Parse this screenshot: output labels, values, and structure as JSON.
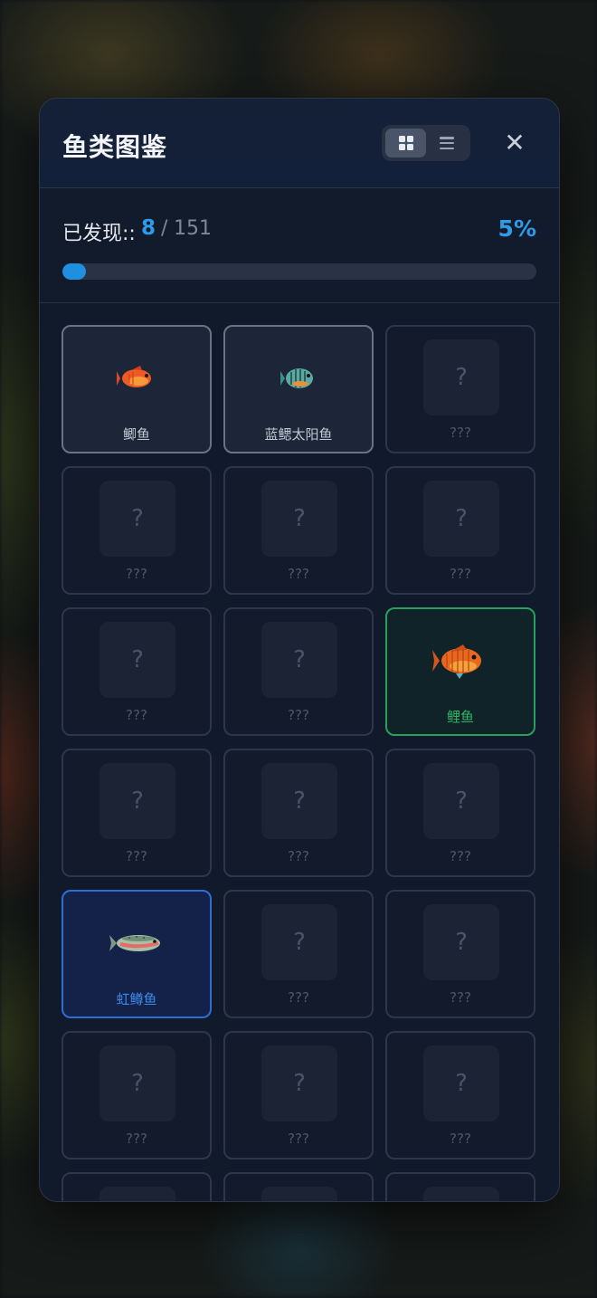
{
  "modal": {
    "title": "鱼类图鉴",
    "close_symbol": "✕"
  },
  "view_toggle": {
    "options": [
      "grid-icon",
      "list-icon"
    ],
    "selected": "grid"
  },
  "progress": {
    "label": "已发现::",
    "found": "8",
    "separator": "/",
    "total": "151",
    "percent_text": "5%",
    "fraction": 0.05
  },
  "fish_cards": [
    {
      "label": "鲫鱼",
      "state": "known",
      "icon": "crucian-carp-icon",
      "question_mark": "?"
    },
    {
      "label": "蓝鳃太阳鱼",
      "state": "known",
      "icon": "bluegill-icon",
      "question_mark": "?"
    },
    {
      "label": "???",
      "state": "unknown",
      "question_mark": "?"
    },
    {
      "label": "???",
      "state": "unknown",
      "question_mark": "?"
    },
    {
      "label": "???",
      "state": "unknown",
      "question_mark": "?"
    },
    {
      "label": "???",
      "state": "unknown",
      "question_mark": "?"
    },
    {
      "label": "???",
      "state": "unknown",
      "question_mark": "?"
    },
    {
      "label": "???",
      "state": "unknown",
      "question_mark": "?"
    },
    {
      "label": "鲤鱼",
      "state": "green",
      "icon": "carp-icon",
      "question_mark": "?"
    },
    {
      "label": "???",
      "state": "unknown",
      "question_mark": "?"
    },
    {
      "label": "???",
      "state": "unknown",
      "question_mark": "?"
    },
    {
      "label": "???",
      "state": "unknown",
      "question_mark": "?"
    },
    {
      "label": "虹鳟鱼",
      "state": "blue",
      "icon": "rainbow-trout-icon",
      "question_mark": "?"
    },
    {
      "label": "???",
      "state": "unknown",
      "question_mark": "?"
    },
    {
      "label": "???",
      "state": "unknown",
      "question_mark": "?"
    },
    {
      "label": "???",
      "state": "unknown",
      "question_mark": "?"
    },
    {
      "label": "???",
      "state": "unknown",
      "question_mark": "?"
    },
    {
      "label": "???",
      "state": "unknown",
      "question_mark": "?"
    },
    {
      "label": "",
      "state": "unknown",
      "question_mark": ""
    },
    {
      "label": "",
      "state": "unknown",
      "question_mark": ""
    },
    {
      "label": "",
      "state": "unknown",
      "question_mark": ""
    }
  ],
  "colors": {
    "accent_blue": "#2f9be8",
    "rare_green": "#27a05c",
    "rare_blue": "#2e6ed3"
  }
}
